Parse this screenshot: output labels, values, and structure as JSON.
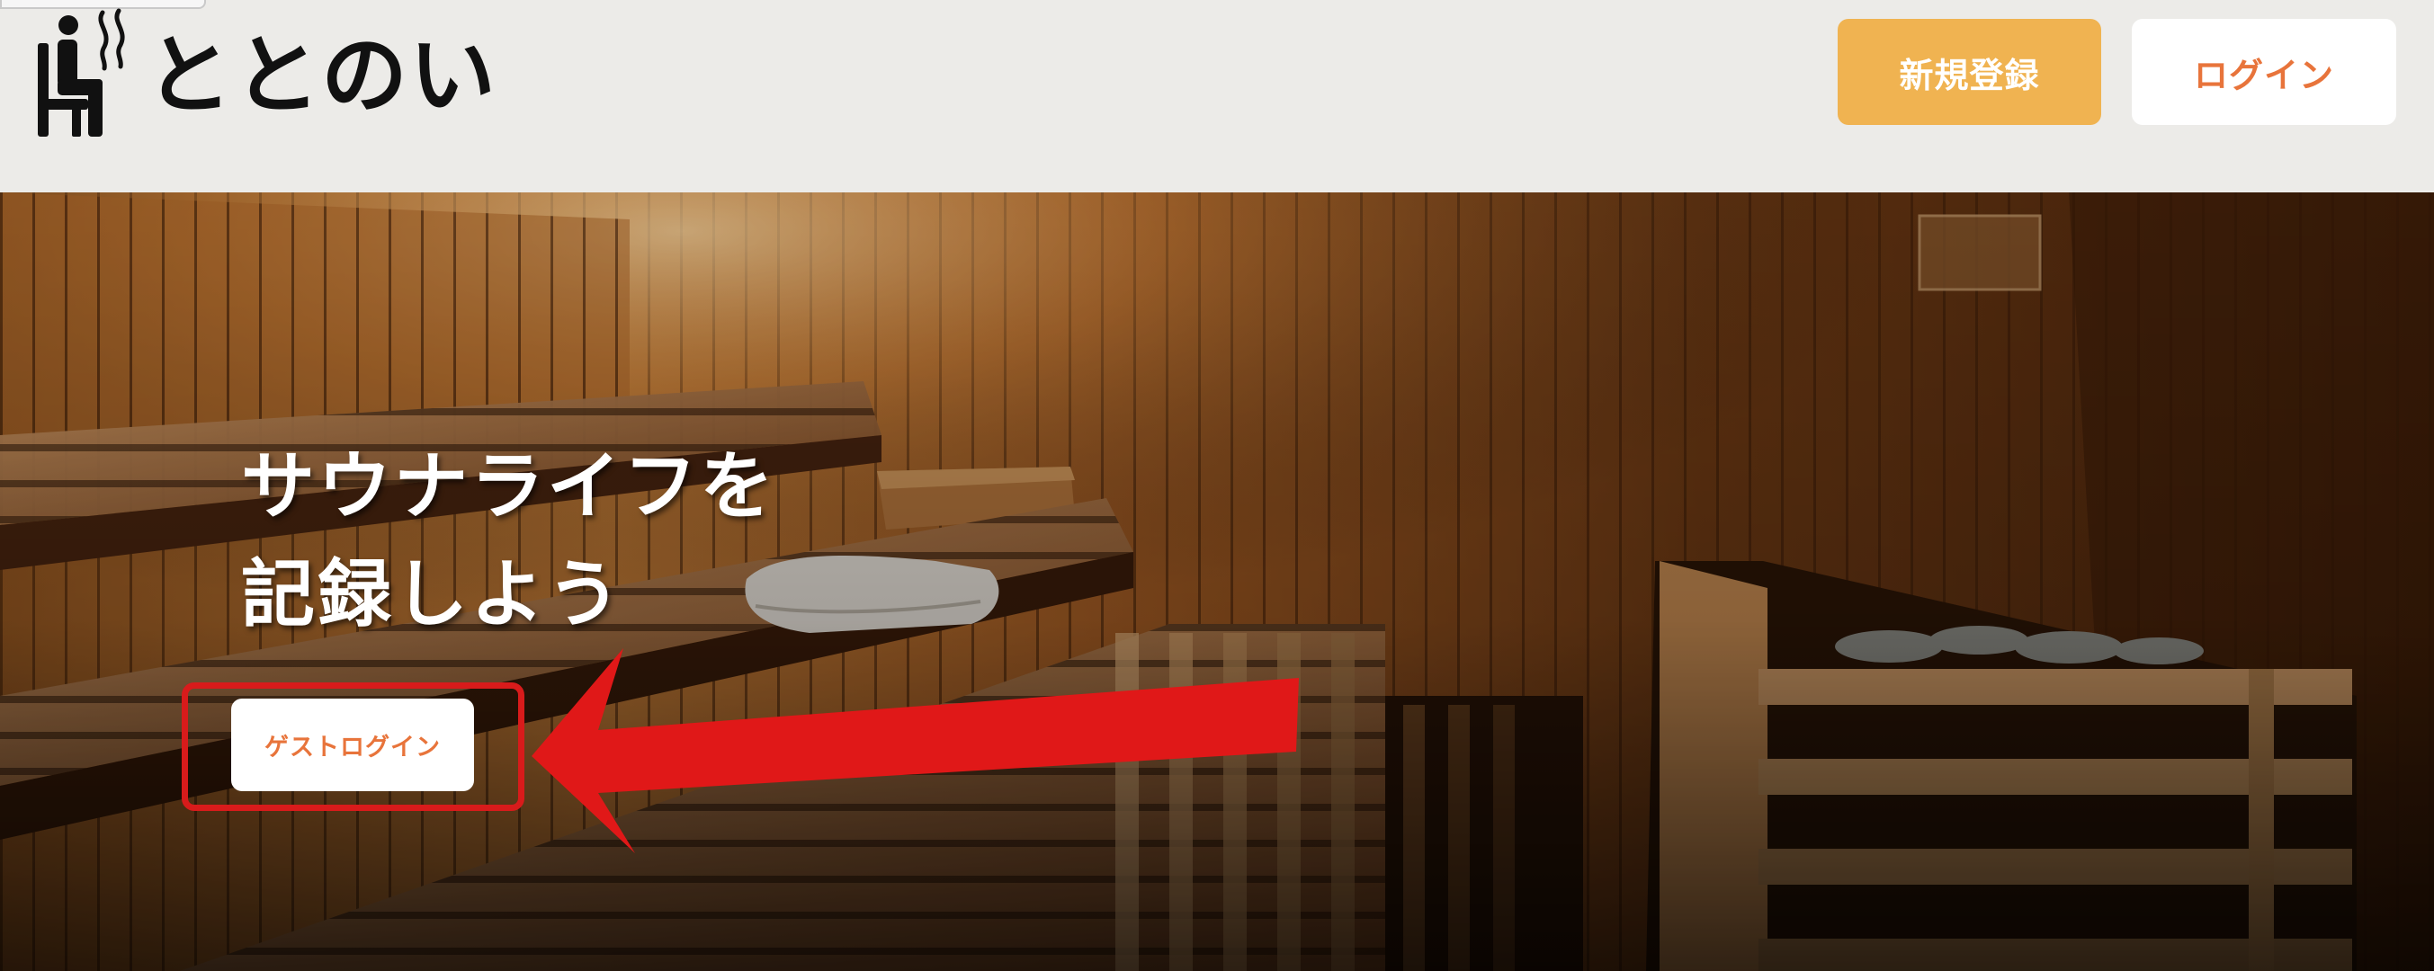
{
  "header": {
    "logo_text": "ととのい",
    "logo_icon": "sauna-person-icon",
    "signup_label": "新規登録",
    "login_label": "ログイン"
  },
  "hero": {
    "headline_line1": "サウナライフを",
    "headline_line2": "記録しよう",
    "guest_login_label": "ゲストログイン",
    "background": "sauna-room-image"
  },
  "annotation": {
    "arrow_color": "#e01818",
    "highlight_color": "#d81b1b"
  },
  "colors": {
    "signup_button": "#f0b351",
    "accent_text": "#e8743b",
    "header_bg": "#ecebe8"
  }
}
